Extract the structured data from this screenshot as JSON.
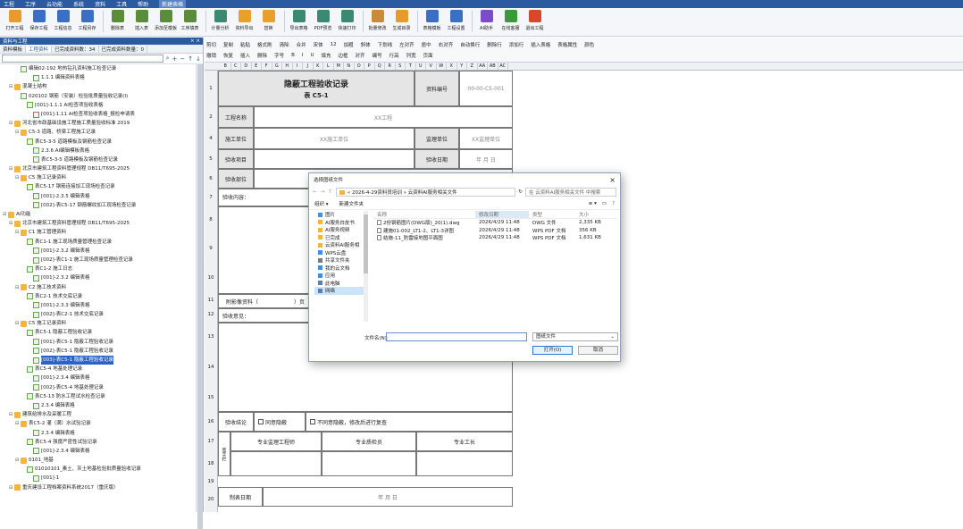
{
  "menu": [
    "工程",
    "工序",
    "云功能",
    "系统",
    "资料",
    "工具",
    "帮助",
    "新建表格"
  ],
  "ribbon": [
    {
      "label": "打开工程",
      "color": "#e89b2a"
    },
    {
      "label": "保存工程",
      "color": "#3a6fc4"
    },
    {
      "label": "工程信息",
      "color": "#3a6fc4"
    },
    {
      "label": "工程另存",
      "color": "#3a6fc4"
    },
    {
      "label": "删除表",
      "color": "#5b8c3a"
    },
    {
      "label": "插入表",
      "color": "#5b8c3a"
    },
    {
      "label": "添加至模板",
      "color": "#5b8c3a"
    },
    {
      "label": "工序填表",
      "color": "#5b8c3a"
    },
    {
      "label": "计量分析",
      "color": "#3a8a6f"
    },
    {
      "label": "资料导出",
      "color": "#e8a02a"
    },
    {
      "label": "替换",
      "color": "#e8a02a"
    },
    {
      "label": "导出表格",
      "color": "#3a8a6f"
    },
    {
      "label": "PDF预览",
      "color": "#3a8a6f"
    },
    {
      "label": "快速打印",
      "color": "#3a8a6f"
    },
    {
      "label": "批量修改",
      "color": "#c98a3a"
    },
    {
      "label": "生成目录",
      "color": "#e89b2a"
    },
    {
      "label": "表格模板",
      "color": "#3a6fc4"
    },
    {
      "label": "工程设置",
      "color": "#3a6fc4"
    },
    {
      "label": "AI助手",
      "color": "#7c4bc9"
    },
    {
      "label": "在线客服",
      "color": "#3a9a3a"
    },
    {
      "label": "退出工程",
      "color": "#d9472b"
    }
  ],
  "left_panel": {
    "title": "资料与工程",
    "tabs": [
      "资料模板",
      "工程资料",
      "已完成资料数：34",
      "已完成资料数量：0"
    ],
    "tree": [
      {
        "i": 2,
        "k": "doc",
        "t": "编辑02-192 地热钻孔资料施工检查记录"
      },
      {
        "i": 4,
        "k": "doc",
        "t": "1.1.1  编辑资料表格"
      },
      {
        "i": 1,
        "k": "folder",
        "t": "混凝土结构"
      },
      {
        "i": 2,
        "k": "doc",
        "t": "020102 钢筋（安装）检验批质量验收记录(Ⅰ)"
      },
      {
        "i": 3,
        "k": "doc",
        "t": "[001]-1.1.1  AI检查项验收表格"
      },
      {
        "i": 4,
        "k": "pdoc",
        "t": "[001]-1.11  AI检查项验收表格_报检申请表"
      },
      {
        "i": 1,
        "k": "folder",
        "t": "河北省市政基础设施工程施工质量验收标准 2019"
      },
      {
        "i": 2,
        "k": "folder",
        "t": "C5-3 道路、桥梁工程施工记录"
      },
      {
        "i": 3,
        "k": "doc",
        "t": "表C5-3-5 道路模板及钢筋检查记录"
      },
      {
        "i": 4,
        "k": "doc",
        "t": "2.3.6  AI编辑模板表格"
      },
      {
        "i": 4,
        "k": "doc",
        "t": "表C5-3-5 道路模板及钢筋检查记录"
      },
      {
        "i": 1,
        "k": "folder",
        "t": "北京市建筑工程资料管理规程 DB11/T695-2025"
      },
      {
        "i": 2,
        "k": "folder",
        "t": "C5 施工记录资料"
      },
      {
        "i": 3,
        "k": "doc",
        "t": "表C5-17 钢筋连接加工现场检查记录"
      },
      {
        "i": 4,
        "k": "doc",
        "t": "[001]-2.3.5  编辑表格"
      },
      {
        "i": 4,
        "k": "doc",
        "t": "[002]-表C5-17 钢筋螺纹加工现场检查记录"
      },
      {
        "i": 0,
        "k": "folder",
        "t": "AI功能"
      },
      {
        "i": 1,
        "k": "folder",
        "t": "北京市建筑工程资料管理规程 DB11/T695-2025"
      },
      {
        "i": 2,
        "k": "folder",
        "t": "C1 施工管理资料"
      },
      {
        "i": 3,
        "k": "doc",
        "t": "表C1-1 施工现场质量管理检查记录"
      },
      {
        "i": 4,
        "k": "doc",
        "t": "[001]-2.3.2  编辑表格"
      },
      {
        "i": 4,
        "k": "doc",
        "t": "[002]-表C1-1 施工现场质量管理检查记录"
      },
      {
        "i": 3,
        "k": "doc",
        "t": "表C1-2 施工日志"
      },
      {
        "i": 4,
        "k": "doc",
        "t": "[001]-2.3.2  编辑表格"
      },
      {
        "i": 2,
        "k": "folder",
        "t": "C2 施工技术资料"
      },
      {
        "i": 3,
        "k": "doc",
        "t": "表C2-1 技术交底记录"
      },
      {
        "i": 4,
        "k": "doc",
        "t": "[001]-2.3.3  编辑表格"
      },
      {
        "i": 4,
        "k": "doc",
        "t": "[002]-表C2-1 技术交底记录"
      },
      {
        "i": 2,
        "k": "folder",
        "t": "C5 施工记录资料"
      },
      {
        "i": 3,
        "k": "doc",
        "t": "表C5-1 隐蔽工程验收记录"
      },
      {
        "i": 4,
        "k": "doc",
        "t": "[001]-表C5-1 隐蔽工程验收记录"
      },
      {
        "i": 4,
        "k": "doc",
        "t": "[002]-表C5-1 隐蔽工程验收记录"
      },
      {
        "i": 4,
        "k": "doc",
        "t": "[003]-表C5-1 隐蔽工程验收记录",
        "sel": true
      },
      {
        "i": 3,
        "k": "doc",
        "t": "表C5-4 地基处理记录"
      },
      {
        "i": 4,
        "k": "doc",
        "t": "[001]-2.3.4  编辑表格"
      },
      {
        "i": 4,
        "k": "doc",
        "t": "[002]-表C5-4 地基处理记录"
      },
      {
        "i": 3,
        "k": "doc",
        "t": "表C5-13 防水工程试水检查记录"
      },
      {
        "i": 4,
        "k": "doc",
        "t": "2.3.4  编辑表格"
      },
      {
        "i": 1,
        "k": "folder",
        "t": "建筑给排水及采暖工程"
      },
      {
        "i": 2,
        "k": "folder",
        "t": "表C5-2 灌（满）水试验记录"
      },
      {
        "i": 4,
        "k": "doc",
        "t": "2.3.4  编辑表格"
      },
      {
        "i": 3,
        "k": "doc",
        "t": "表C5-4 强度严密性试验记录"
      },
      {
        "i": 4,
        "k": "doc",
        "t": "[001]-2.3.4  编辑表格"
      },
      {
        "i": 2,
        "k": "folder",
        "t": "0101_地基"
      },
      {
        "i": 3,
        "k": "doc",
        "t": "01010101_素土、灰土地基检验批质量验收记录"
      },
      {
        "i": 4,
        "k": "doc",
        "t": "[001]-1"
      },
      {
        "i": 1,
        "k": "folder",
        "t": "重庆建设工程档案资料系统2017（重庆版）"
      }
    ]
  },
  "editor": {
    "tool_row1": [
      "剪切",
      "复制",
      "粘贴",
      "格式刷",
      "清除",
      "合并",
      "宋体",
      "12",
      "加粗",
      "斜体",
      "下划线",
      "左对齐",
      "居中",
      "右对齐",
      "自动换行",
      "删除行",
      "添加行",
      "插入表格",
      "表格属性",
      "颜色"
    ],
    "tool_row2": [
      "撤销",
      "恢复",
      "插入",
      "删除",
      "字号",
      "B",
      "I",
      "U",
      "填充",
      "边框",
      "对齐",
      "编号",
      "行高",
      "列宽",
      "页面"
    ],
    "columns": [
      "B",
      "C",
      "D",
      "E",
      "F",
      "G",
      "H",
      "I",
      "J",
      "K",
      "L",
      "M",
      "N",
      "O",
      "P",
      "Q",
      "R",
      "S",
      "T",
      "U",
      "V",
      "W",
      "X",
      "Y",
      "Z",
      "AA",
      "AB",
      "AC"
    ]
  },
  "form": {
    "title": "隐蔽工程验收记录",
    "subtitle": "表 C5-1",
    "doc_no_label": "资料编号",
    "doc_no_value": "00-00-C5-001",
    "project_label": "工程名称",
    "project_value": "XX工程",
    "construct_label": "施工单位",
    "construct_value": "XX施工单位",
    "supervise_label": "监理单位",
    "supervise_value": "XX监理单位",
    "project_part_label": "验收项目",
    "date_label": "验收日期",
    "date_value": "年  月  日",
    "part_label": "验收部位",
    "content_label": "验收内容：",
    "attach_label": "附影像资料（",
    "attach_tail": "）页",
    "opinion_label": "验收意见：",
    "conclusion_label": "验收结论",
    "agree": "同意隐蔽",
    "disagree": "不同意隐蔽，修改后进行复查",
    "sig_supervisor": "专业监理工程师",
    "sig_quality": "专业质检员",
    "sig_foreman": "专业工长",
    "sig_unit": "签字栏",
    "fill_date_label": "制表日期",
    "fill_date_value": "年  月  日",
    "row_numbers": [
      "1",
      "2",
      "3",
      "4",
      "5",
      "6",
      "7",
      "8",
      "9",
      "10",
      "11",
      "12",
      "13",
      "14",
      "15",
      "16",
      "17",
      "18",
      "19",
      "20"
    ]
  },
  "dialog": {
    "title": "选择图纸文件",
    "path": "« 2026-4-29资料员培训 » 云资料AI服务相关文件",
    "search_placeholder": "在 云资料AI服务相关文件 中搜索",
    "organize": "组织 ▾",
    "new_folder": "新建文件夹",
    "nav": [
      {
        "label": "图片",
        "color": "#4a90d9"
      },
      {
        "label": "AI服务白皮书",
        "color": "#f3b53b"
      },
      {
        "label": "AI服务视频",
        "color": "#f3b53b"
      },
      {
        "label": "已完成",
        "color": "#f3b53b"
      },
      {
        "label": "云资料AI服务相",
        "color": "#f3b53b"
      },
      {
        "label": "WPS云盘",
        "color": "#3c8ee6"
      },
      {
        "label": "共享文件夹",
        "color": "#7a7a7a"
      },
      {
        "label": "我的云文档",
        "color": "#3c8ee6"
      },
      {
        "label": "应用",
        "color": "#3c8ee6"
      },
      {
        "label": "此电脑",
        "color": "#5a7fb4"
      },
      {
        "label": "网络",
        "color": "#5a7fb4",
        "cur": true
      }
    ],
    "headers": [
      "名称",
      "修改日期",
      "类型",
      "大小"
    ],
    "files": [
      {
        "name": "2份钢筋图片(DWG版)_20(1).dwg",
        "date": "2026/4/29 11:48",
        "type": "DWG 文件",
        "size": "2,335 KB"
      },
      {
        "name": "建施01-002_LT1-2、LT1-3详图",
        "date": "2026/4/29 11:48",
        "type": "WPS PDF 文档",
        "size": "356 KB"
      },
      {
        "name": "结施-11_防雷接地图平面图",
        "date": "2026/4/29 11:48",
        "type": "WPS PDF 文档",
        "size": "1,631 KB"
      }
    ],
    "filename_label": "文件名(N):",
    "filter": "图纸文件",
    "open": "打开(O)",
    "cancel": "取消"
  }
}
